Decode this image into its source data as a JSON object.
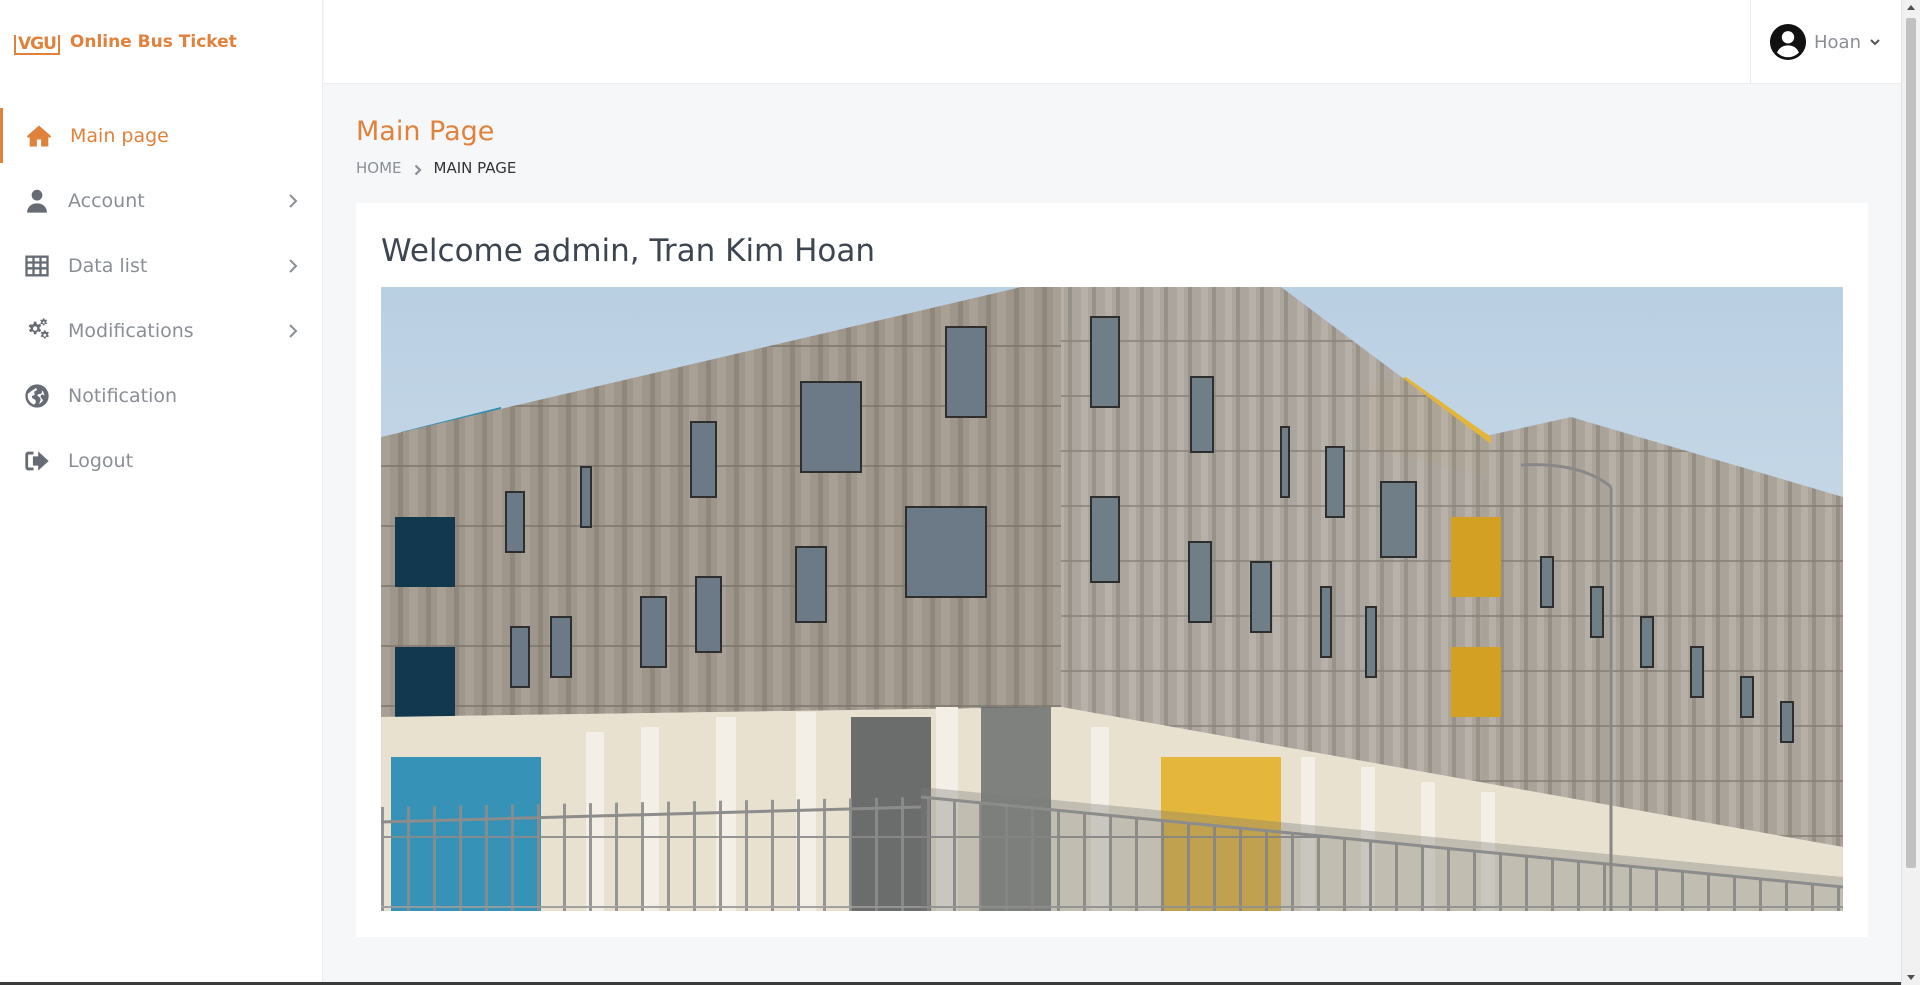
{
  "brand": {
    "logo_text": "VGU",
    "name": "Online Bus Ticket",
    "accent": "#e0823c"
  },
  "sidebar": {
    "items": [
      {
        "label": "Main page",
        "icon": "home-icon",
        "active": true,
        "has_submenu": false
      },
      {
        "label": "Account",
        "icon": "user-icon",
        "active": false,
        "has_submenu": true
      },
      {
        "label": "Data list",
        "icon": "table-icon",
        "active": false,
        "has_submenu": true
      },
      {
        "label": "Modifications",
        "icon": "gears-icon",
        "active": false,
        "has_submenu": true
      },
      {
        "label": "Notification",
        "icon": "globe-icon",
        "active": false,
        "has_submenu": false
      },
      {
        "label": "Logout",
        "icon": "logout-icon",
        "active": false,
        "has_submenu": false
      }
    ]
  },
  "topbar": {
    "user_name": "Hoan",
    "avatar_icon": "user-circle-icon"
  },
  "main": {
    "title": "Main Page",
    "breadcrumb": {
      "home": "HOME",
      "current": "MAIN PAGE"
    },
    "welcome": "Welcome admin, Tran Kim Hoan",
    "hero_image": "campus-building-photo"
  }
}
